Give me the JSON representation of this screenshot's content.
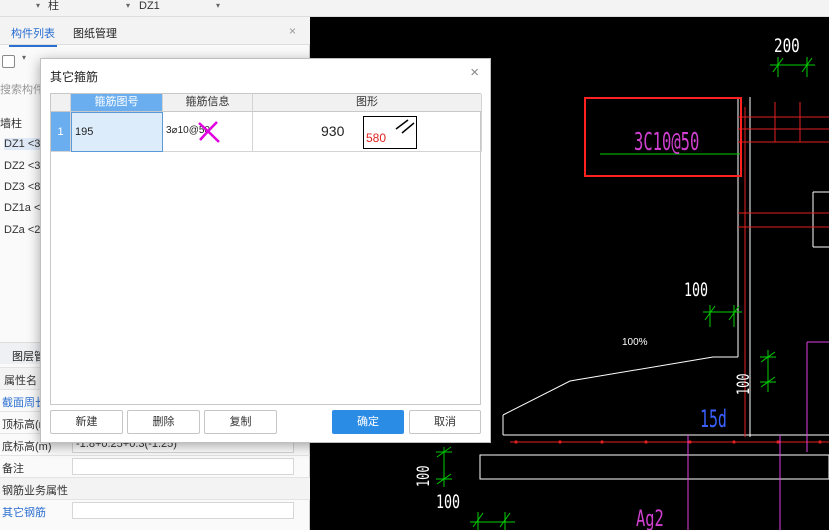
{
  "topbar": {
    "selector1": "柱",
    "selector2": "DZ1"
  },
  "left_panel": {
    "tabs": [
      "构件列表",
      "图纸管理"
    ],
    "search_placeholder": "搜索构件",
    "tree": {
      "group": "墙柱",
      "items": [
        "DZ1 <3",
        "DZ2 <3",
        "DZ3 <8",
        "DZ1a <",
        "DZa <2"
      ]
    },
    "layer_tab": "图层管",
    "property_header": "属性名",
    "properties": [
      {
        "label": "截面周长",
        "value": "",
        "blue": true
      },
      {
        "label": "顶标高(m",
        "value": ""
      },
      {
        "label": "底标高(m)",
        "value": "-1.8+0.25+0.3(-1.25)"
      },
      {
        "label": "备注",
        "value": ""
      }
    ],
    "rebar_section": "钢筋业务属性",
    "other_rebar": "其它钢筋"
  },
  "cad": {
    "dim_200": "200",
    "label_3c": "3C10@50",
    "dim_100_mid": "100",
    "percent": "100%",
    "dim_100_side": "100",
    "label_15d": "15d",
    "dim_100_left": "100",
    "dim_100_bottom": "100",
    "label_ag": "Ag2"
  },
  "dialog": {
    "title": "其它箍筋",
    "columns": [
      "箍筋图号",
      "箍筋信息",
      "图形"
    ],
    "rows": [
      {
        "num": "1",
        "figure_no": "195",
        "info": "3⌀10@50",
        "length": "930",
        "shape_value": "580"
      }
    ],
    "buttons": {
      "new": "新建",
      "delete": "删除",
      "copy": "复制",
      "ok": "确定",
      "cancel": "取消"
    }
  },
  "colors": {
    "accent": "#2b8ce6",
    "header_active": "#6aaef0",
    "cad_bg": "#000000",
    "highlight_red": "#ff2020",
    "cad_magenta": "#e040e0",
    "cad_green": "#00d000"
  }
}
